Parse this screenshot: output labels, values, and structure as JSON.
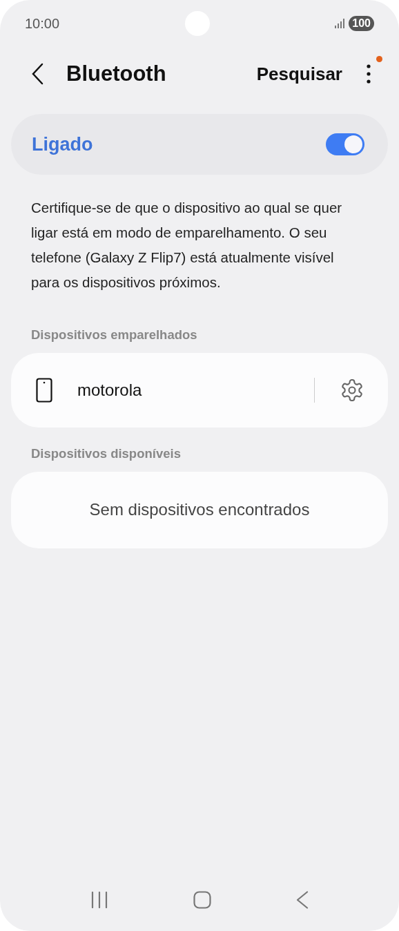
{
  "status_bar": {
    "time": "10:00",
    "battery": "100"
  },
  "header": {
    "title": "Bluetooth",
    "action": "Pesquisar",
    "menu_badge": true
  },
  "master_switch": {
    "label": "Ligado",
    "on": true
  },
  "description": "Certifique-se de que o dispositivo ao qual se quer ligar está em modo de emparelhamento. O seu telefone (Galaxy Z Flip7) está atualmente visível para os dispositivos próximos.",
  "paired": {
    "heading": "Dispositivos emparelhados",
    "devices": [
      {
        "name": "motorola"
      }
    ]
  },
  "available": {
    "heading": "Dispositivos disponíveis",
    "empty_text": "Sem dispositivos encontrados"
  }
}
